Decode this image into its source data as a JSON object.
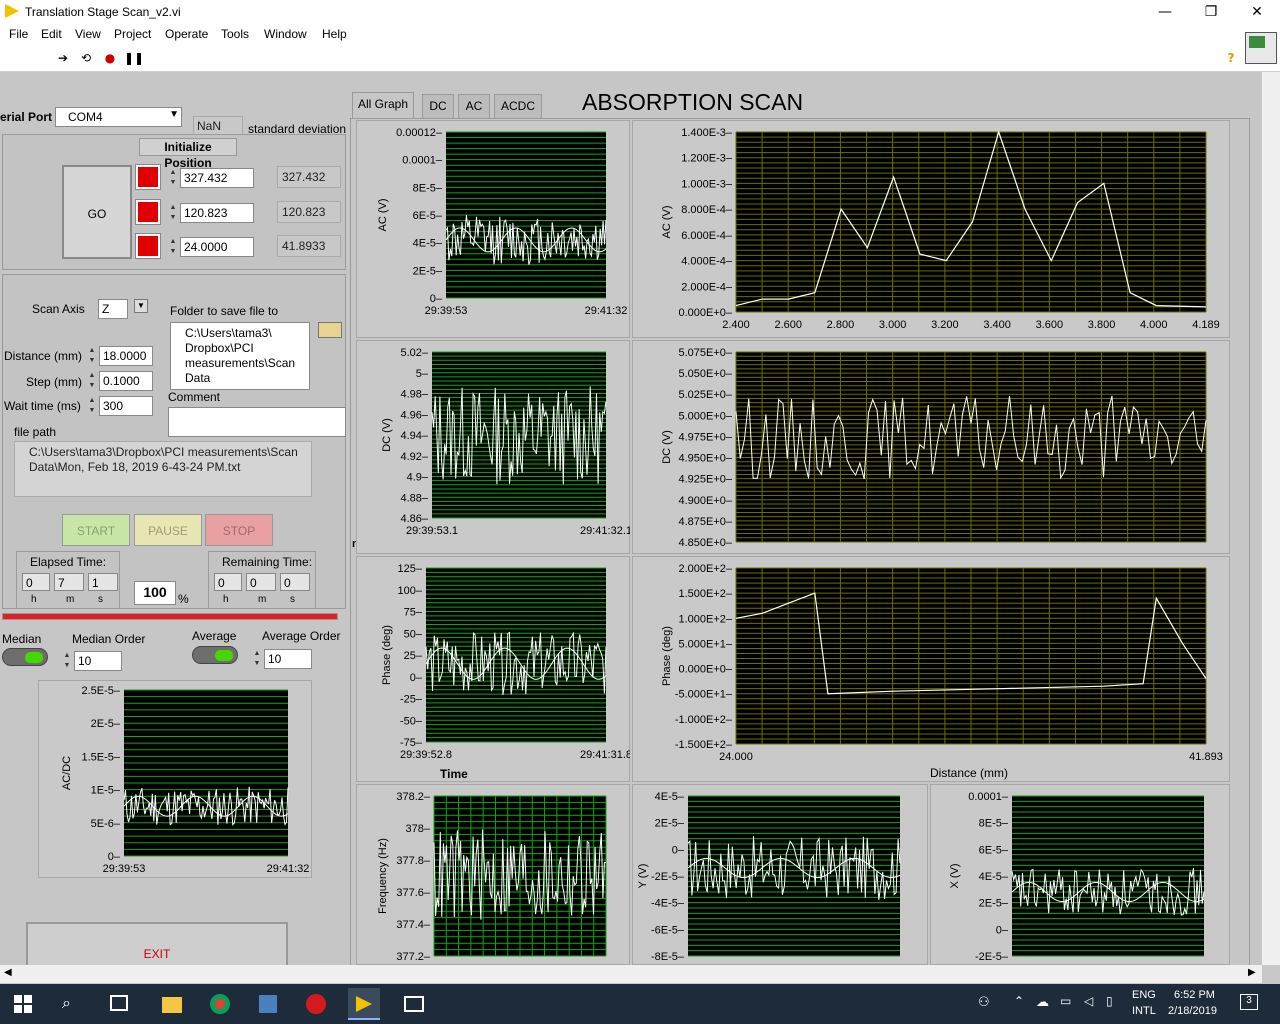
{
  "window": {
    "title": "Translation Stage Scan_v2.vi",
    "controls": [
      "—",
      "❐",
      "✕"
    ]
  },
  "menu": [
    "File",
    "Edit",
    "View",
    "Project",
    "Operate",
    "Tools",
    "Window",
    "Help"
  ],
  "serial": {
    "label": "erial Port",
    "value": "COM4",
    "nan": "NaN",
    "std_label": "standard deviation"
  },
  "init_button": "Initialize Position",
  "go_button": "GO",
  "positions": [
    {
      "set": "327.432",
      "read": "327.432"
    },
    {
      "set": "120.823",
      "read": "120.823"
    },
    {
      "set": "24.0000",
      "read": "41.8933"
    }
  ],
  "scan": {
    "axis_label": "Scan Axis",
    "axis_value": "Z",
    "folder_label": "Folder to save file to",
    "folder_value": "C:\\Users\\tama3\\ Dropbox\\PCI measurements\\Scan Data",
    "distance_label": "Distance (mm)",
    "distance": "18.0000",
    "step_label": "Step (mm)",
    "step": "0.1000",
    "wait_label": "Wait time (ms)",
    "wait": "300",
    "comment_label": "Comment",
    "comment": "",
    "filepath_label": "file path",
    "filepath": "C:\\Users\\tama3\\Dropbox\\PCI measurements\\Scan Data\\Mon, Feb 18, 2019 6-43-24 PM.txt"
  },
  "run": {
    "start": "START",
    "pause": "PAUSE",
    "stop": "STOP"
  },
  "elapsed": {
    "label": "Elapsed Time:",
    "h": "0",
    "m": "7",
    "s": "1"
  },
  "remaining": {
    "label": "Remaining Time:",
    "h": "0",
    "m": "0",
    "s": "0"
  },
  "units": {
    "h": "h",
    "m": "m",
    "s": "s"
  },
  "percent": {
    "value": "100",
    "unit": "%"
  },
  "progress": 1.0,
  "filters": {
    "median_label": "Median",
    "median_order_label": "Median Order",
    "median_order": "10",
    "average_label": "Average",
    "average_order_label": "Average Order",
    "average_order": "10"
  },
  "exit_button": "EXIT",
  "scan_title": "ABSORPTION SCAN",
  "tabs": [
    "All Graph",
    "DC",
    "AC",
    "ACDC"
  ],
  "time_axis_label": "Time",
  "time_axis_label_clipped": "ne",
  "distance_axis_label": "Distance (mm)",
  "graphs": [
    {
      "id": "acdc_small",
      "ylabel": "AC/DC",
      "yticks": [
        "2.5E-5",
        "2E-5",
        "1.5E-5",
        "1E-5",
        "5E-6",
        "0"
      ],
      "xticks": [
        "29:39:53",
        "29:41:32"
      ],
      "grid": "horizontal"
    },
    {
      "id": "ac_time",
      "ylabel": "AC (V)",
      "yticks": [
        "0.00012",
        "0.0001",
        "8E-5",
        "6E-5",
        "4E-5",
        "2E-5",
        "0"
      ],
      "xticks": [
        "29:39:53",
        "29:41:32"
      ],
      "grid": "horizontal"
    },
    {
      "id": "dc_time",
      "ylabel": "DC (V)",
      "yticks": [
        "5.02",
        "5",
        "4.98",
        "4.96",
        "4.94",
        "4.92",
        "4.9",
        "4.88",
        "4.86"
      ],
      "xticks": [
        "29:39:53.1",
        "29:41:32.1"
      ],
      "grid": "horizontal"
    },
    {
      "id": "phase_time",
      "ylabel": "Phase (deg)",
      "yticks": [
        "125",
        "100",
        "75",
        "50",
        "25",
        "0",
        "-25",
        "-50",
        "-75"
      ],
      "xticks": [
        "29:39:52.8",
        "29:41:31.8"
      ],
      "grid": "horizontal"
    },
    {
      "id": "ac_dist",
      "ylabel": "AC (V)",
      "yticks": [
        "1.400E-3",
        "1.200E-3",
        "1.000E-3",
        "8.000E-4",
        "6.000E-4",
        "4.000E-4",
        "2.000E-4",
        "0.000E+0"
      ],
      "xticks": [
        "2.400",
        "2.600",
        "2.800",
        "3.000",
        "3.200",
        "3.400",
        "3.600",
        "3.800",
        "4.000",
        "4.189"
      ],
      "grid": "both-yellow"
    },
    {
      "id": "dc_dist",
      "ylabel": "DC (V)",
      "yticks": [
        "5.075E+0",
        "5.050E+0",
        "5.025E+0",
        "5.000E+0",
        "4.975E+0",
        "4.950E+0",
        "4.925E+0",
        "4.900E+0",
        "4.875E+0",
        "4.850E+0"
      ],
      "xticks": [],
      "grid": "both-yellow"
    },
    {
      "id": "phase_dist",
      "ylabel": "Phase (deg)",
      "yticks": [
        "2.000E+2",
        "1.500E+2",
        "1.000E+2",
        "5.000E+1",
        "0.000E+0",
        "-5.000E+1",
        "-1.000E+2",
        "-1.500E+2"
      ],
      "xticks": [
        "24.000",
        "41.893"
      ],
      "grid": "both-yellow"
    },
    {
      "id": "freq",
      "ylabel": "Frequency (Hz)",
      "yticks": [
        "378.2",
        "378",
        "377.8",
        "377.6",
        "377.4",
        "377.2"
      ],
      "xticks": [],
      "grid": "both"
    },
    {
      "id": "y",
      "ylabel": "Y (V)",
      "yticks": [
        "4E-5",
        "2E-5",
        "0",
        "-2E-5",
        "-4E-5",
        "-6E-5",
        "-8E-5"
      ],
      "xticks": [],
      "grid": "horizontal"
    },
    {
      "id": "x",
      "ylabel": "X (V)",
      "yticks": [
        "0.0001",
        "8E-5",
        "6E-5",
        "4E-5",
        "2E-5",
        "0",
        "-2E-5"
      ],
      "xticks": [],
      "grid": "horizontal"
    }
  ],
  "chart_data": [
    {
      "type": "line",
      "ylabel": "AC (V)",
      "xlabel": "Distance (mm)",
      "ylim": [
        0,
        0.0014
      ],
      "x": [
        2.4,
        2.5,
        2.6,
        2.7,
        2.8,
        2.9,
        3.0,
        3.1,
        3.2,
        3.3,
        3.4,
        3.5,
        3.6,
        3.7,
        3.8,
        3.9,
        4.0,
        4.189
      ],
      "y": [
        5e-05,
        0.0001,
        0.0001,
        0.00015,
        0.0008,
        0.0005,
        0.00105,
        0.00045,
        0.0004,
        0.0007,
        0.0014,
        0.0008,
        0.0004,
        0.00085,
        0.001,
        0.00015,
        5e-05,
        4e-05
      ]
    },
    {
      "type": "line",
      "ylabel": "Phase (deg)",
      "xlabel": "Distance (mm)",
      "ylim": [
        -150,
        200
      ],
      "x": [
        24.0,
        25.0,
        26.0,
        27.0,
        27.5,
        30.0,
        34.0,
        38.0,
        39.5,
        40.0,
        41.0,
        41.893
      ],
      "y": [
        100,
        110,
        130,
        150,
        -50,
        -45,
        -40,
        -35,
        -30,
        140,
        50,
        -20
      ]
    }
  ],
  "taskbar": {
    "lang1": "ENG",
    "lang2": "INTL",
    "time": "6:52 PM",
    "date": "2/18/2019",
    "badge": "3"
  }
}
